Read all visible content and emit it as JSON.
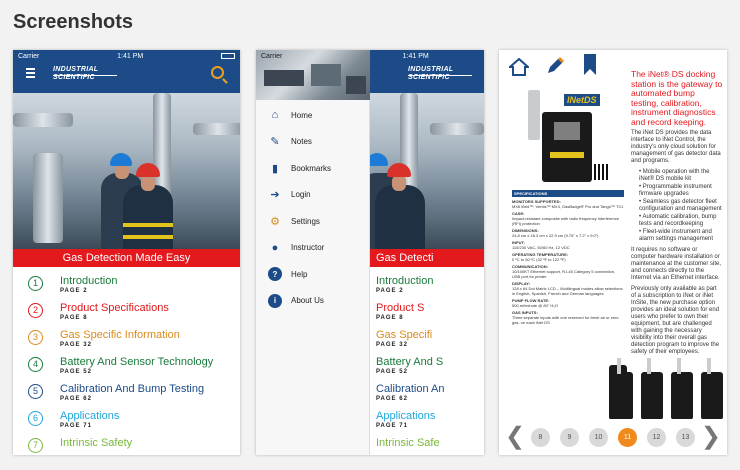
{
  "heading": "Screenshots",
  "status": {
    "carrier": "Carrier",
    "time": "1:41 PM"
  },
  "brand": {
    "line1": "INDUSTRIAL",
    "line2": "SCIENTIFIC"
  },
  "banner": "Gas Detection Made Easy",
  "toc": [
    {
      "num": "1",
      "title": "Introduction",
      "page": "PAGE 2",
      "color": "#1a7a3c"
    },
    {
      "num": "2",
      "title": "Product Specifications",
      "page": "PAGE 8",
      "color": "#e3191e"
    },
    {
      "num": "3",
      "title": "Gas Specific Information",
      "page": "PAGE 32",
      "color": "#d98b1e"
    },
    {
      "num": "4",
      "title": "Battery And Sensor Technology",
      "page": "PAGE 52",
      "color": "#1a7a3c"
    },
    {
      "num": "5",
      "title": "Calibration And Bump Testing",
      "page": "PAGE 62",
      "color": "#1c4b88"
    },
    {
      "num": "6",
      "title": "Applications",
      "page": "PAGE 71",
      "color": "#1fa7dc"
    },
    {
      "num": "7",
      "title": "Intrinsic Safety",
      "page": "",
      "color": "#7ab83a"
    }
  ],
  "toc_short": [
    "Introduction",
    "Product S",
    "Gas Specifi",
    "Battery And S",
    "Calibration An",
    "Applications",
    "Intrinsic Safe"
  ],
  "banner_short": "Gas Detecti",
  "menu": [
    {
      "label": "Home",
      "icon": "home-icon"
    },
    {
      "label": "Notes",
      "icon": "pencil-icon"
    },
    {
      "label": "Bookmarks",
      "icon": "bookmark-icon"
    },
    {
      "label": "Login",
      "icon": "login-icon"
    },
    {
      "label": "Settings",
      "icon": "gear-icon"
    },
    {
      "label": "Instructor",
      "icon": "person-icon"
    },
    {
      "label": "Help",
      "icon": "help-icon"
    },
    {
      "label": "About Us",
      "icon": "info-icon"
    }
  ],
  "page": {
    "title": "The iNet® DS docking station is the gateway to automated bump testing, calibration, instrument diagnostics and record keeping.",
    "p1": "The iNet DS provides the data interface to iNet Control, the industry's only cloud solution for management of gas detector data and programs.",
    "bullets": [
      "Mobile operation with the iNet® DS mobile kit",
      "Programmable instrument firmware upgrades",
      "Seamless gas detector fleet configuration and management",
      "Automatic calibration, bump tests and recordkeeping",
      "Fleet-wide instrument and alarm settings management"
    ],
    "p2": "It requires no software or computer hardware installation or maintenance at the customer site, and connects directly to the Internet via an Ethernet interface.",
    "p3": "Previously only available as part of a subscription to iNet or iNet InSite, the new purchase option provides an ideal solution for end users who prefer to own their equipment, but are challenged with gaining the necessary visibility into their overall gas detection program to improve the safety of their employees.",
    "logo": "INetDS",
    "spec_header": "SPECIFICATIONS",
    "spec": [
      {
        "h": "MONITORS SUPPORTED:",
        "t": "MX6 iBrid™, Ventis™ MX4, GasBadge® Pro and Tango™ TX1"
      },
      {
        "h": "CASE:",
        "t": "Impact-resistant composite with radio frequency interference (RFI) protection"
      },
      {
        "h": "DIMENSIONS:",
        "t": "24.8 cm x 18.3 cm x 22.9 cm (9.75\" x 7.2\" x 9.0\")"
      },
      {
        "h": "INPUT:",
        "t": "115/230 VAC, 50/60 Hz, 12 VDC"
      },
      {
        "h": "OPERATING TEMPERATURE:",
        "t": "0 ºC to 50 ºC (32 ºF to 122 ºF)"
      },
      {
        "h": "COMMUNICATION:",
        "t": "10/100KT Ethernet support, RJ-45 Category 5 connection, USB port for printer"
      },
      {
        "h": "DISPLAY:",
        "t": "128 x 64 Dot Matrix LCD – Multilingual modes allow selections in English, Spanish, French and German languages"
      },
      {
        "h": "PUMP FLOW RATE:",
        "t": "500 ml/minute @ 80\" H₂O"
      },
      {
        "h": "GAS INPUTS:",
        "t": "Three separate inputs with one reserved for fresh air or zero gas, on each iNet DS"
      }
    ]
  },
  "pages": [
    "8",
    "9",
    "10",
    "11",
    "12",
    "13"
  ],
  "active_page": "11",
  "colors": {
    "navy": "#1c4b88",
    "red": "#e3191e",
    "orange": "#f08a1c"
  }
}
